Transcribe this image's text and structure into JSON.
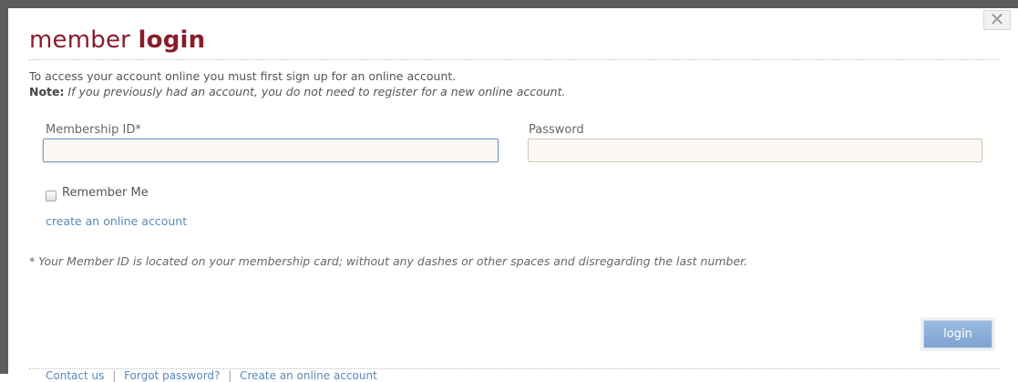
{
  "dialog": {
    "close_glyph": "✕",
    "title_light": "member",
    "title_bold": "login"
  },
  "intro": {
    "line1": "To access your account online you must first sign up for an online account.",
    "note_label": "Note:",
    "note_text": "If you previously had an account, you do not need to register for a new online account."
  },
  "form": {
    "membership_id_label": "Membership ID*",
    "membership_id_value": "",
    "password_label": "Password",
    "password_value": "",
    "remember_label": "Remember Me",
    "remember_checked": false,
    "create_account_link": "create an online account",
    "footnote": "* Your Member ID is located on your membership card; without any dashes or other spaces and disregarding the last number.",
    "login_button": "login"
  },
  "footer": {
    "links": [
      "Contact us",
      "Forgot password?",
      "Create an online account"
    ],
    "separator": "|"
  },
  "colors": {
    "title": "#8a1c2c",
    "link": "#5a88b8",
    "button": "#8eb0da"
  }
}
